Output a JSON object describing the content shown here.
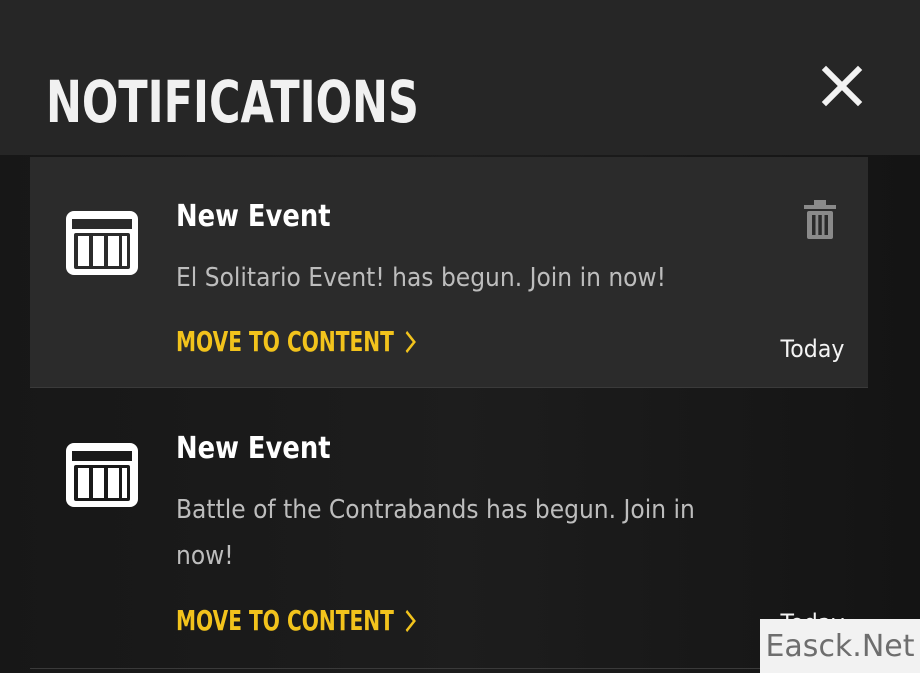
{
  "header": {
    "title": "NOTIFICATIONS",
    "close_icon": "close-icon"
  },
  "notifications": [
    {
      "icon": "event-crate-icon",
      "title": "New Event",
      "body": "El Solitario Event! has begun. Join in now!",
      "link_label": "MOVE TO CONTENT",
      "date": "Today",
      "selected": true,
      "delete_icon": "trash-icon"
    },
    {
      "icon": "event-crate-icon",
      "title": "New Event",
      "body": "Battle of the Contrabands has begun. Join in now!",
      "link_label": "MOVE TO CONTENT",
      "date": "Today",
      "selected": false
    }
  ],
  "watermark": "Easck.Net",
  "colors": {
    "accent": "#f2c31c",
    "header_bg": "#262626",
    "selected_bg": "#2b2b2b",
    "panel_bg": "#171717"
  }
}
